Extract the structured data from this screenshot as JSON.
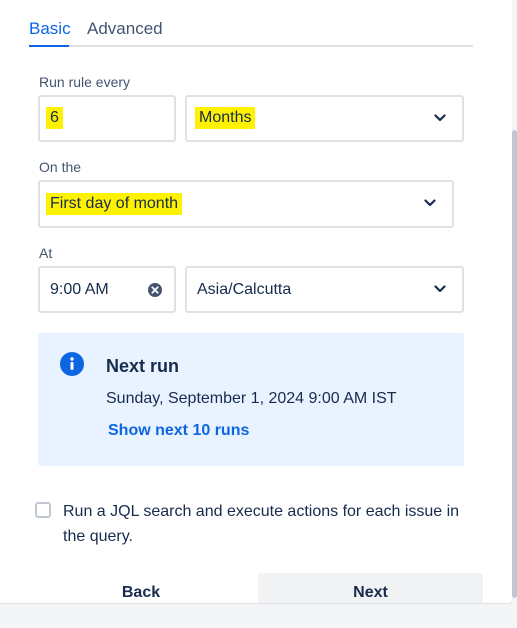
{
  "tabs": {
    "basic": "Basic",
    "advanced": "Advanced"
  },
  "run_rule": {
    "label": "Run rule every",
    "interval_value": "6",
    "unit": "Months"
  },
  "on_the": {
    "label": "On the",
    "value": "First day of month"
  },
  "at": {
    "label": "At",
    "time": "9:00 AM",
    "timezone": "Asia/Calcutta"
  },
  "next_run": {
    "title": "Next run",
    "date": "Sunday, September 1, 2024 9:00 AM IST",
    "link": "Show next 10 runs"
  },
  "jql_option": {
    "checked": false,
    "text": "Run a JQL search and execute actions for each issue in the query."
  },
  "buttons": {
    "back": "Back",
    "next": "Next"
  },
  "colors": {
    "accent": "#0c66e4",
    "highlight": "#fff200",
    "info_bg": "#e9f2ff"
  },
  "icons": [
    "chevron-down-icon",
    "clear-icon",
    "info-icon",
    "checkbox"
  ]
}
